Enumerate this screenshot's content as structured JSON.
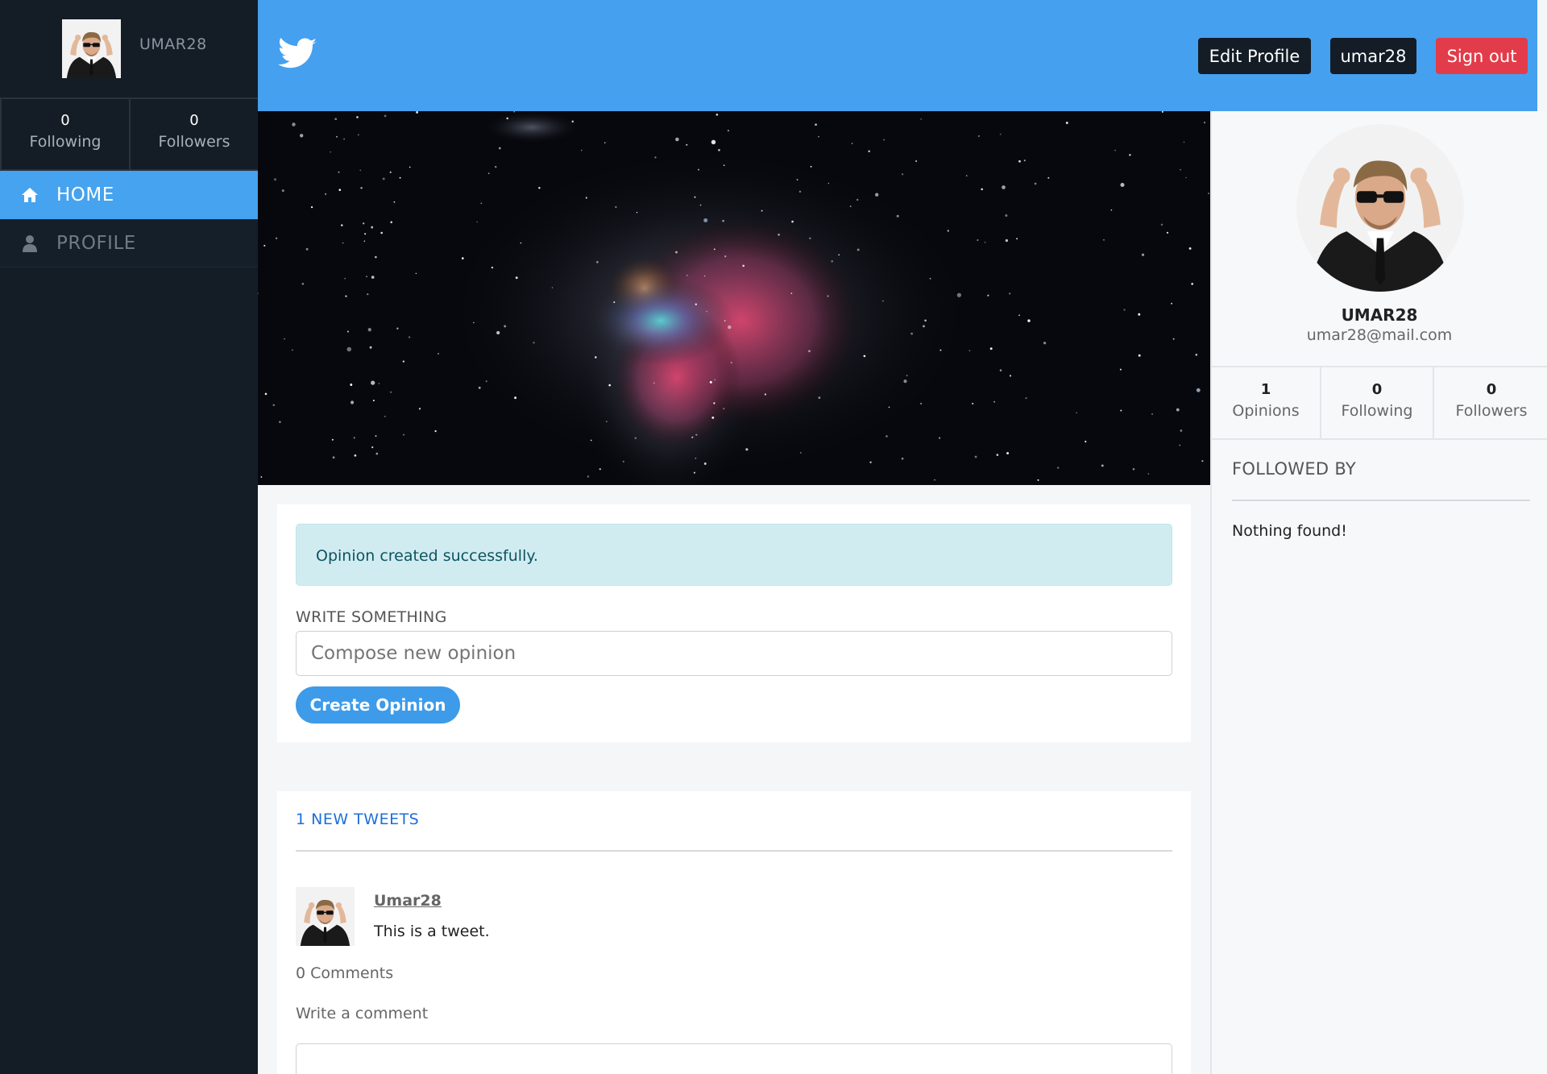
{
  "sidebar": {
    "username": "UMAR28",
    "stats": [
      {
        "count": "0",
        "label": "Following"
      },
      {
        "count": "0",
        "label": "Followers"
      }
    ],
    "nav": [
      {
        "label": "HOME",
        "icon": "home-icon",
        "active": true
      },
      {
        "label": "PROFILE",
        "icon": "user-icon",
        "active": false
      }
    ]
  },
  "header": {
    "logo_icon": "twitter-bird-icon",
    "edit_profile_label": "Edit Profile",
    "user_label": "umar28",
    "sign_out_label": "Sign out",
    "colors": {
      "bar": "#45a0ef",
      "dark_button": "#141d26",
      "danger": "#e23c4a"
    }
  },
  "compose": {
    "alert": "Opinion created successfully.",
    "label": "WRITE SOMETHING",
    "placeholder": "Compose new opinion",
    "button_label": "Create Opinion"
  },
  "feed": {
    "title": "1 NEW TWEETS",
    "tweets": [
      {
        "author": "Umar28",
        "text": "This is a tweet.",
        "comments": "0 Comments",
        "write_comment": "Write a comment"
      }
    ]
  },
  "profile_panel": {
    "name": "UMAR28",
    "email": "umar28@mail.com",
    "stats": [
      {
        "count": "1",
        "label": "Opinions"
      },
      {
        "count": "0",
        "label": "Following"
      },
      {
        "count": "0",
        "label": "Followers"
      }
    ],
    "followed_by_title": "FOLLOWED BY",
    "followed_by_empty": "Nothing found!"
  }
}
